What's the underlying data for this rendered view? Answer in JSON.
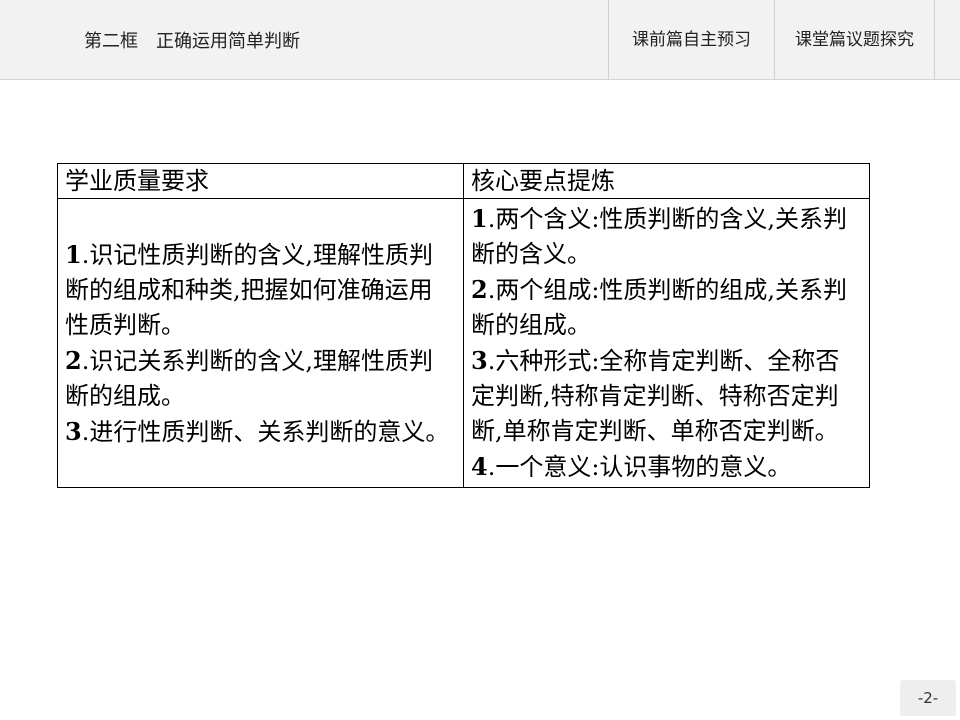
{
  "header": {
    "lesson_title": "第二框　正确运用简单判断",
    "tabs": [
      "课前篇自主预习",
      "课堂篇议题探究"
    ]
  },
  "table": {
    "headers": [
      "学业质量要求",
      "核心要点提炼"
    ],
    "left_items": [
      {
        "num": "1",
        "text": ".识记性质判断的含义,理解性质判断的组成和种类,把握如何准确运用性质判断。"
      },
      {
        "num": "2",
        "text": ".识记关系判断的含义,理解性质判断的组成。"
      },
      {
        "num": "3",
        "text": ".进行性质判断、关系判断的意义。"
      }
    ],
    "right_items": [
      {
        "num": "1",
        "text": ".两个含义:性质判断的含义,关系判断的含义。"
      },
      {
        "num": "2",
        "text": ".两个组成:性质判断的组成,关系判断的组成。"
      },
      {
        "num": "3",
        "text": ".六种形式:全称肯定判断、全称否定判断,特称肯定判断、特称否定判断,单称肯定判断、单称否定判断。"
      },
      {
        "num": "4",
        "text": ".一个意义:认识事物的意义。"
      }
    ]
  },
  "footer": {
    "page_number": "-2-"
  }
}
